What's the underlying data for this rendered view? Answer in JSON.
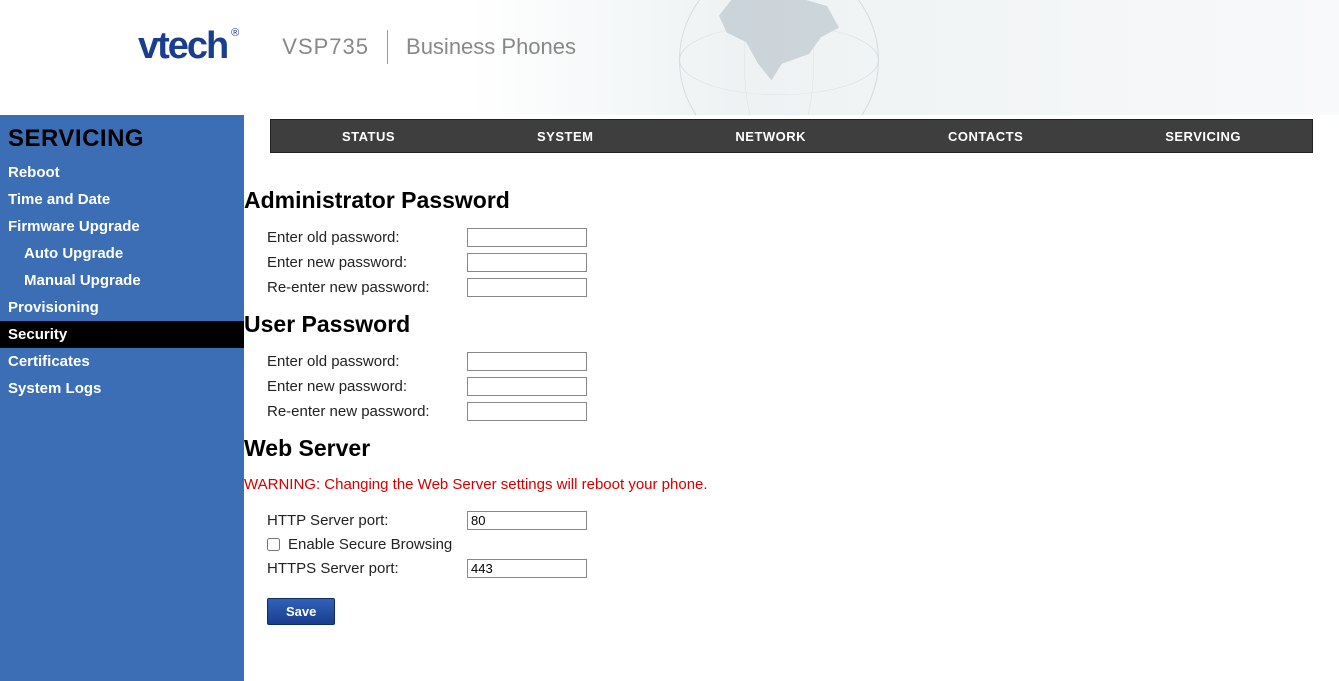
{
  "header": {
    "brand": "vtech",
    "reg": "®",
    "model": "VSP735",
    "tagline": "Business Phones"
  },
  "topnav": {
    "items": [
      {
        "label": "STATUS"
      },
      {
        "label": "SYSTEM"
      },
      {
        "label": "NETWORK"
      },
      {
        "label": "CONTACTS"
      },
      {
        "label": "SERVICING"
      }
    ]
  },
  "sidebar": {
    "title": "SERVICING",
    "items": [
      {
        "label": "Reboot"
      },
      {
        "label": "Time and Date"
      },
      {
        "label": "Firmware Upgrade"
      },
      {
        "label": "Auto Upgrade",
        "sub": true
      },
      {
        "label": "Manual Upgrade",
        "sub": true
      },
      {
        "label": "Provisioning"
      },
      {
        "label": "Security",
        "active": true
      },
      {
        "label": "Certificates"
      },
      {
        "label": "System Logs"
      }
    ]
  },
  "sections": {
    "admin_password": {
      "title": "Administrator Password",
      "rows": [
        {
          "label": "Enter old password:",
          "value": ""
        },
        {
          "label": "Enter new password:",
          "value": ""
        },
        {
          "label": "Re-enter new password:",
          "value": ""
        }
      ]
    },
    "user_password": {
      "title": "User Password",
      "rows": [
        {
          "label": "Enter old password:",
          "value": ""
        },
        {
          "label": "Enter new password:",
          "value": ""
        },
        {
          "label": "Re-enter new password:",
          "value": ""
        }
      ]
    },
    "web_server": {
      "title": "Web Server",
      "warning": "WARNING: Changing the Web Server settings will reboot your phone.",
      "http_port_label": "HTTP Server port:",
      "http_port_value": "80",
      "enable_secure_label": "Enable Secure Browsing",
      "enable_secure_checked": false,
      "https_port_label": "HTTPS Server port:",
      "https_port_value": "443"
    }
  },
  "buttons": {
    "save": "Save"
  }
}
